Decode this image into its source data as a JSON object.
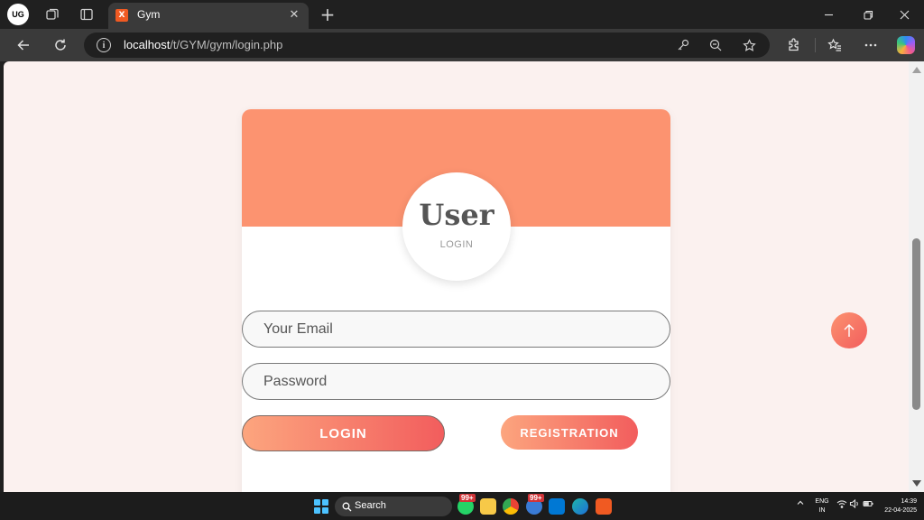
{
  "browser": {
    "profile_initials": "UG",
    "tab": {
      "title": "Gym",
      "favicon_label": "X"
    },
    "url": {
      "host": "localhost",
      "path": "/t/GYM/gym/login.php"
    },
    "icons": [
      "back-arrow-icon",
      "refresh-icon",
      "info-icon",
      "key-icon",
      "zoom-out-icon",
      "star-icon",
      "extensions-icon",
      "favorites-icon",
      "more-icon",
      "copilot-icon"
    ]
  },
  "page": {
    "card": {
      "title": "User",
      "subtitle": "LOGIN",
      "header_color": "#fc9370"
    },
    "form": {
      "email_placeholder": "Your Email",
      "password_placeholder": "Password",
      "login_label": "LOGIN",
      "registration_label": "REGISTRATION"
    },
    "accent_gradient": [
      "#fca57e",
      "#f25d5d"
    ],
    "background_color": "#fbf1ef"
  },
  "taskbar": {
    "search_label": "Search",
    "badges": [
      "99+",
      "99+"
    ],
    "language": {
      "line1": "ENG",
      "line2": "IN"
    },
    "time": "14:39",
    "date": "22-04-2025"
  }
}
